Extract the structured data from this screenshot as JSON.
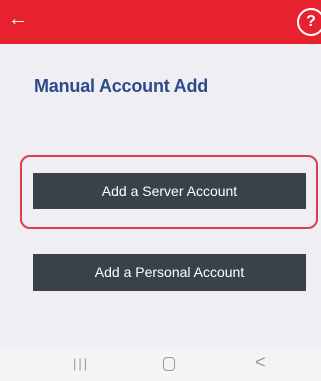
{
  "header": {
    "back_icon": "arrow-left-icon",
    "back_glyph": "←",
    "help_icon": "question-circle-icon",
    "help_glyph": "?",
    "color": "#e8212e"
  },
  "page": {
    "title": "Manual Account Add"
  },
  "buttons": {
    "server_label": "Add a Server Account",
    "personal_label": "Add a Personal Account",
    "button_color": "#394149",
    "highlight_color": "#d9404a"
  },
  "navbar": {
    "recents_glyph": "|||",
    "recents_icon": "recents-icon",
    "home_icon": "home-icon",
    "back_glyph": "<",
    "back_icon": "back-chevron-icon"
  }
}
